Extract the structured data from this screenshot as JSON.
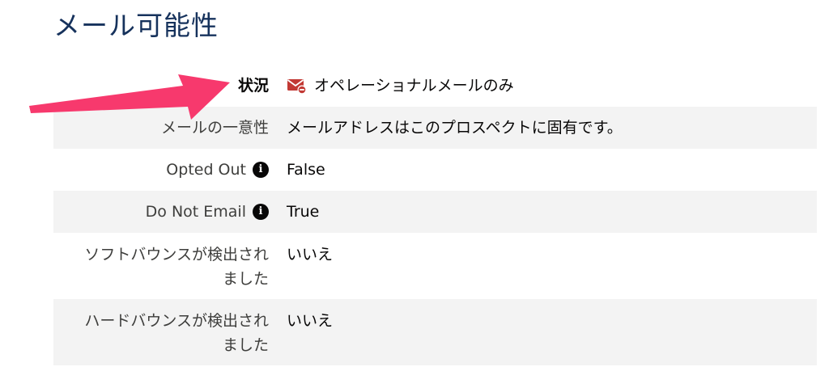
{
  "section": {
    "title": "メール可能性"
  },
  "fields": [
    {
      "label": "状況",
      "value": "オペレーショナルメールのみ",
      "icon": "mail-restricted-icon"
    },
    {
      "label": "メールの一意性",
      "value": "メールアドレスはこのプロスペクトに固有です。"
    },
    {
      "label": "Opted Out",
      "value": "False",
      "info_icon": "info-icon"
    },
    {
      "label": "Do Not Email",
      "value": "True",
      "info_icon": "info-icon"
    },
    {
      "label": "ソフトバウンスが検出されました",
      "value": "いいえ"
    },
    {
      "label": "ハードバウンスが検出されました",
      "value": "いいえ"
    }
  ],
  "info_glyph": "i",
  "colors": {
    "title": "#16325c",
    "shaded_row": "#f3f3f3",
    "mail_icon": "#c23934",
    "arrow": "#f7396d"
  }
}
